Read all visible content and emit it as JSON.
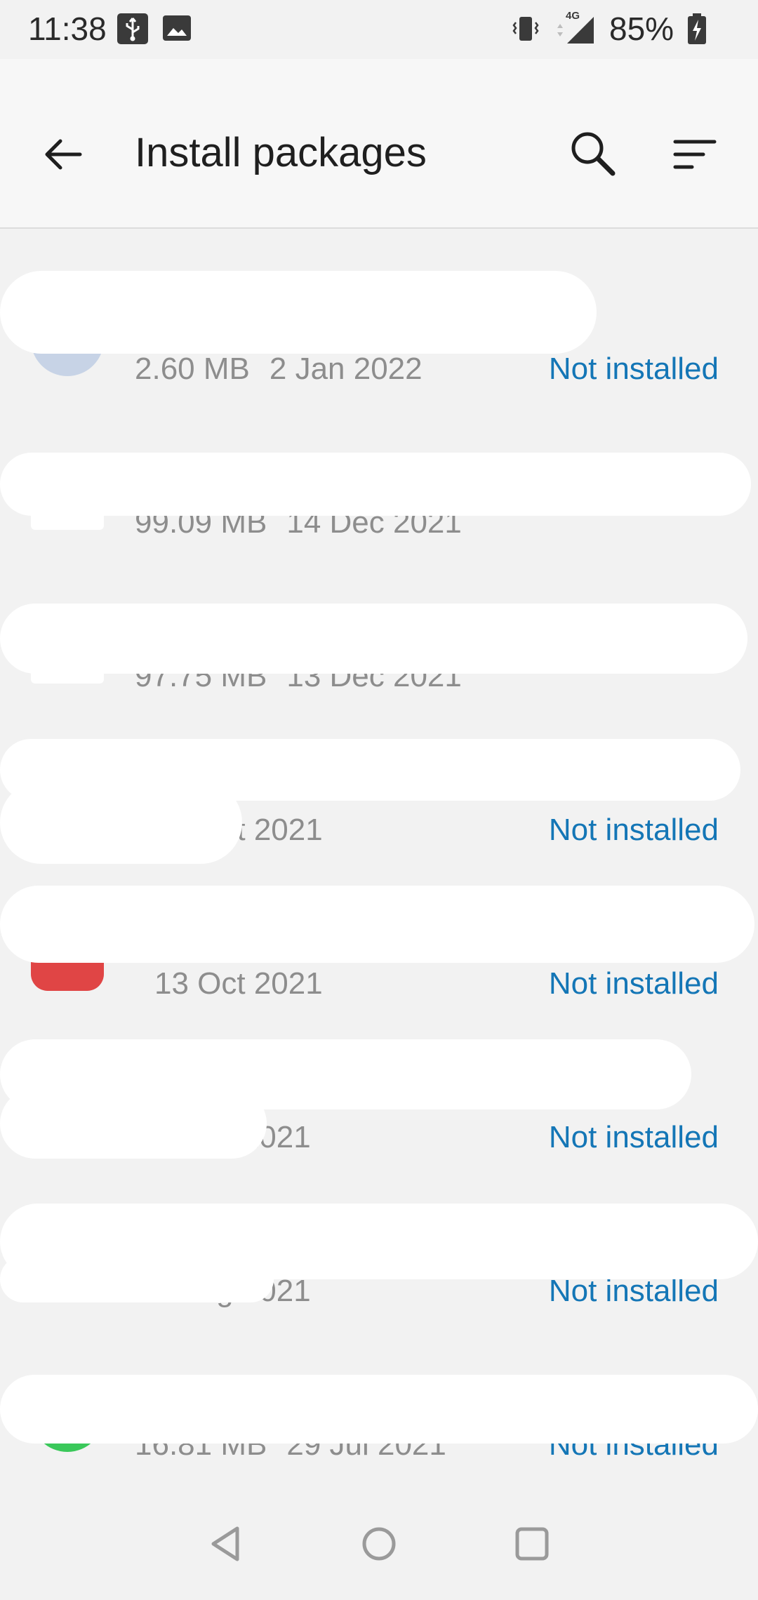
{
  "status_bar": {
    "time": "11:38",
    "network": "4G",
    "battery": "85%"
  },
  "app_bar": {
    "title": "Install packages",
    "back_icon": "arrow-back-icon",
    "search_icon": "search-icon",
    "sort_icon": "sort-icon"
  },
  "packages": [
    {
      "name": "",
      "size": "2.60 MB",
      "date": "2 Jan 2022",
      "status": "Not installed",
      "icon_color": "#c7d3e6"
    },
    {
      "name": "",
      "size": "99.09 MB",
      "date": "14 Dec 2021",
      "status": "",
      "icon_color": "#ffffff"
    },
    {
      "name": "",
      "size": "97.75 MB",
      "date": "13 Dec 2021",
      "status": "",
      "icon_color": "#ffffff"
    },
    {
      "name": "",
      "size": "",
      "date": "29 Oct 2021",
      "status": "Not installed",
      "icon_color": "#ffffff"
    },
    {
      "name": "",
      "size": "",
      "date": "13 Oct 2021",
      "status": "Not installed",
      "icon_color": "#e04545"
    },
    {
      "name": "",
      "size": "",
      "date": "9 Aug 2021",
      "status": "Not installed",
      "icon_color": "#2ecc52"
    },
    {
      "name": "",
      "size": "",
      "date": "4 Aug 2021",
      "status": "Not installed",
      "icon_color": "#1c4aa0"
    },
    {
      "name": "",
      "size": "16.81 MB",
      "date": "29 Jul 2021",
      "status": "Not installed",
      "icon_color": "#3ac85a"
    }
  ],
  "nav_bar": {
    "back_icon": "nav-back-icon",
    "home_icon": "nav-home-icon",
    "recents_icon": "nav-recents-icon"
  },
  "colors": {
    "background": "#f2f2f2",
    "accent": "#1476b6",
    "secondary_text": "#8d8d8d"
  }
}
